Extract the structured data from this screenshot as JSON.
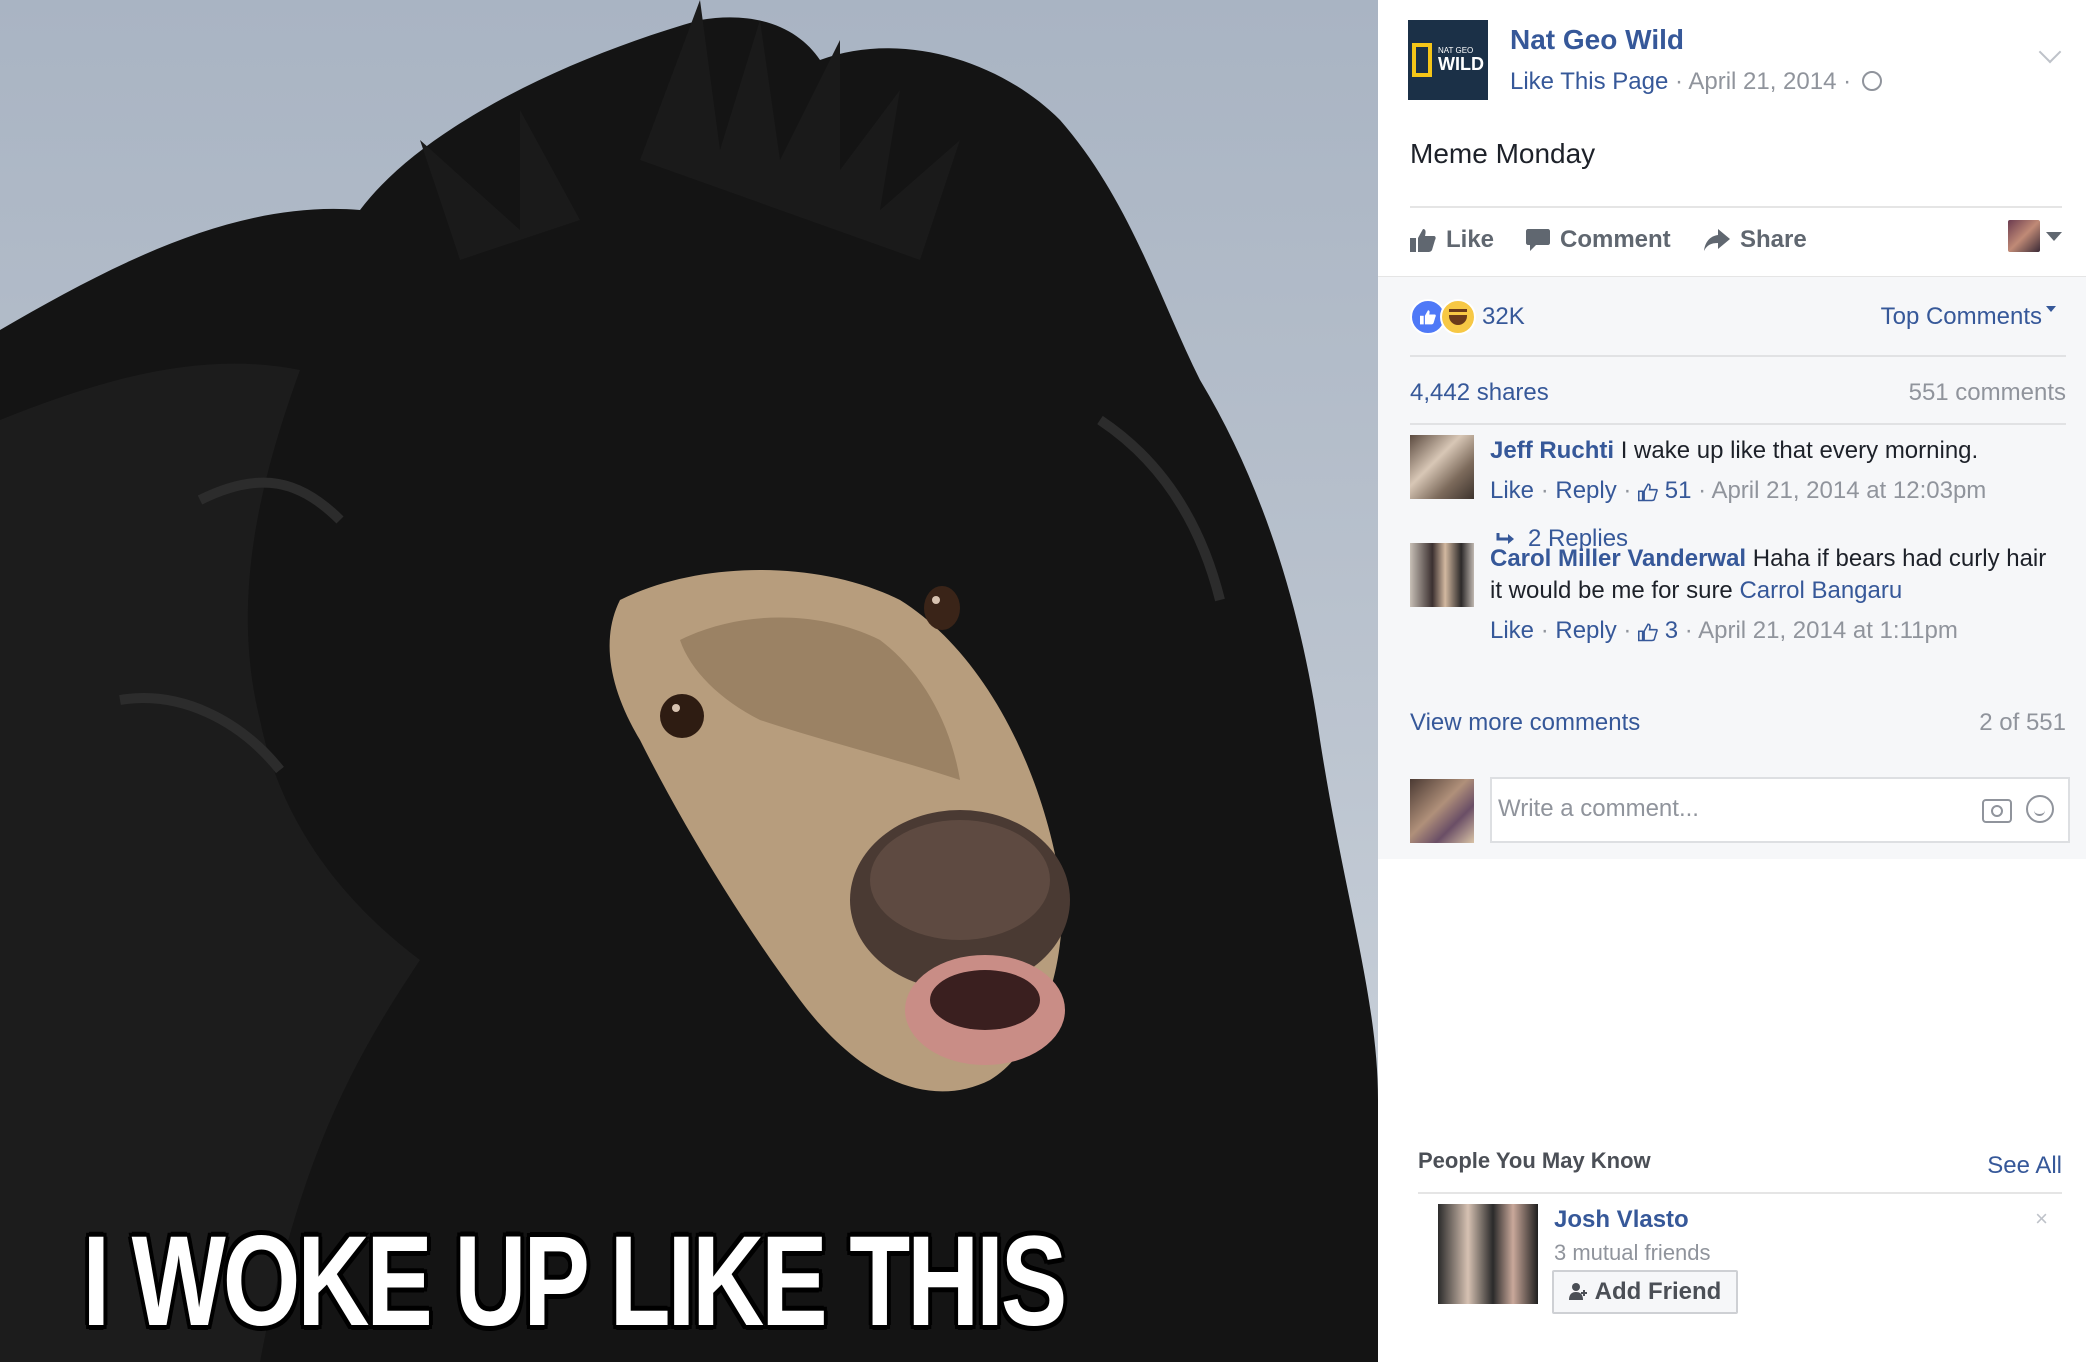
{
  "photo": {
    "caption": "I WOKE UP LIKE THIS"
  },
  "post": {
    "page_name": "Nat Geo Wild",
    "logo_text": "WILD",
    "logo_small_text": "NAT GEO",
    "like_page": "Like This Page",
    "meta_sep": " · ",
    "date": "April 21, 2014",
    "text": "Meme Monday"
  },
  "actions": {
    "like": "Like",
    "comment": "Comment",
    "share": "Share"
  },
  "feedback": {
    "reaction_count": "32K",
    "top_comments": "Top Comments",
    "shares": "4,442 shares",
    "comments": "551 comments"
  },
  "comments": [
    {
      "name": "Jeff Ruchti",
      "text": "I wake up like that every morning.",
      "like": "Like",
      "reply": "Reply",
      "likes": "51",
      "time": "April 21, 2014 at 12:03pm"
    },
    {
      "name": "Carol Miller Vanderwal",
      "text": "Haha if bears had curly hair it would be me for sure",
      "mention": "Carrol Bangaru",
      "like": "Like",
      "reply": "Reply",
      "likes": "3",
      "time": "April 21, 2014 at 1:11pm"
    }
  ],
  "replies_link": "2 Replies",
  "view_more": "View more comments",
  "paging": "2 of 551",
  "composer": {
    "placeholder": "Write a comment..."
  },
  "pymk": {
    "title": "People You May Know",
    "see_all": "See All",
    "person_name": "Josh Vlasto",
    "mutual": "3 mutual friends",
    "add_friend": "Add Friend",
    "dismiss": "×"
  },
  "colors": {
    "link": "#365899",
    "muted": "#90949c",
    "feedback_bg": "#f6f7f9"
  }
}
